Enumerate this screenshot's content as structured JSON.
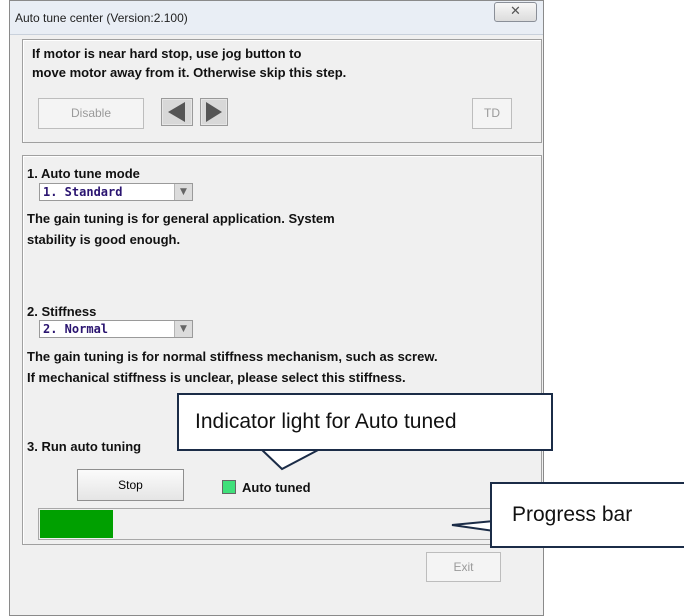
{
  "window": {
    "title": "Auto tune center (Version:2.100)",
    "close_glyph": "✕"
  },
  "section_jog": {
    "instruction_line1": "If motor is near hard stop, use jog button to",
    "instruction_line2": "move motor away from it. Otherwise skip this step.",
    "disable_label": "Disable",
    "jog_left_icon": "left-triangle-icon",
    "jog_right_icon": "right-triangle-icon",
    "td_label": "TD"
  },
  "section_tune": {
    "mode_heading": "1. Auto tune mode",
    "mode_value": "1. Standard",
    "mode_desc_line1": "The gain tuning is for general application. System",
    "mode_desc_line2": "stability is good enough.",
    "stiffness_heading": "2. Stiffness",
    "stiffness_value": "2. Normal",
    "stiffness_desc_line1": "The gain tuning is for normal stiffness mechanism, such as screw.",
    "stiffness_desc_line2": "If mechanical stiffness is unclear, please select this stiffness.",
    "run_heading": "3. Run auto tuning",
    "stop_label": "Stop",
    "auto_tuned_label": "Auto tuned",
    "indicator_color": "#3fe07a",
    "progress_fraction": 0.15,
    "progress_color": "#00a000"
  },
  "footer": {
    "exit_label": "Exit"
  },
  "callouts": {
    "indicator": "Indicator light for Auto tuned",
    "progress": "Progress bar"
  }
}
